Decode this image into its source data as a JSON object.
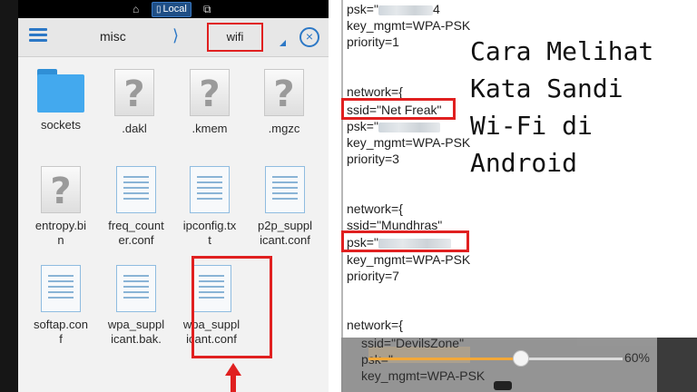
{
  "status_bar": {
    "storage_label": "Local"
  },
  "file_manager": {
    "breadcrumb": {
      "parent": "misc",
      "separator": "⟩",
      "current": "wifi"
    },
    "files": [
      {
        "name": "sockets",
        "type": "folder"
      },
      {
        "name": ".dakl",
        "type": "unknown"
      },
      {
        "name": ".kmem",
        "type": "unknown"
      },
      {
        "name": ".mgzc",
        "type": "unknown"
      },
      {
        "name": "entropy.bi\nn",
        "type": "unknown"
      },
      {
        "name": "freq_count\ner.conf",
        "type": "document"
      },
      {
        "name": "ipconfig.tx\nt",
        "type": "document"
      },
      {
        "name": "p2p_suppl\nicant.conf",
        "type": "document"
      },
      {
        "name": "softap.con\nf",
        "type": "document"
      },
      {
        "name": "wpa_suppl\nicant.bak.",
        "type": "document"
      },
      {
        "name": "wpa_suppl\nicant.conf",
        "type": "document"
      }
    ]
  },
  "config_text": {
    "lines": [
      "psk=\"",
      "key_mgmt=WPA-PSK",
      "priority=1",
      "network={",
      "ssid=\"Net Freak\"",
      "psk=\"",
      "key_mgmt=WPA-PSK",
      "priority=3",
      "network={",
      "ssid=\"Mundhras\"",
      "psk=\"",
      "key_mgmt=WPA-PSK",
      "priority=7",
      "network={",
      "ssid=\"DevilsZone\"",
      "psk=\"",
      "key_mgmt=WPA-PSK"
    ],
    "line1_suffix": "4"
  },
  "overlay_title": "Cara Melihat\nKata Sandi\nWi-Fi di\nAndroid",
  "player": {
    "progress_label": "60%",
    "progress": 0.6
  },
  "colors": {
    "accent": "#2c78c6",
    "highlight": "#e02020",
    "progress": "#f2a128"
  }
}
